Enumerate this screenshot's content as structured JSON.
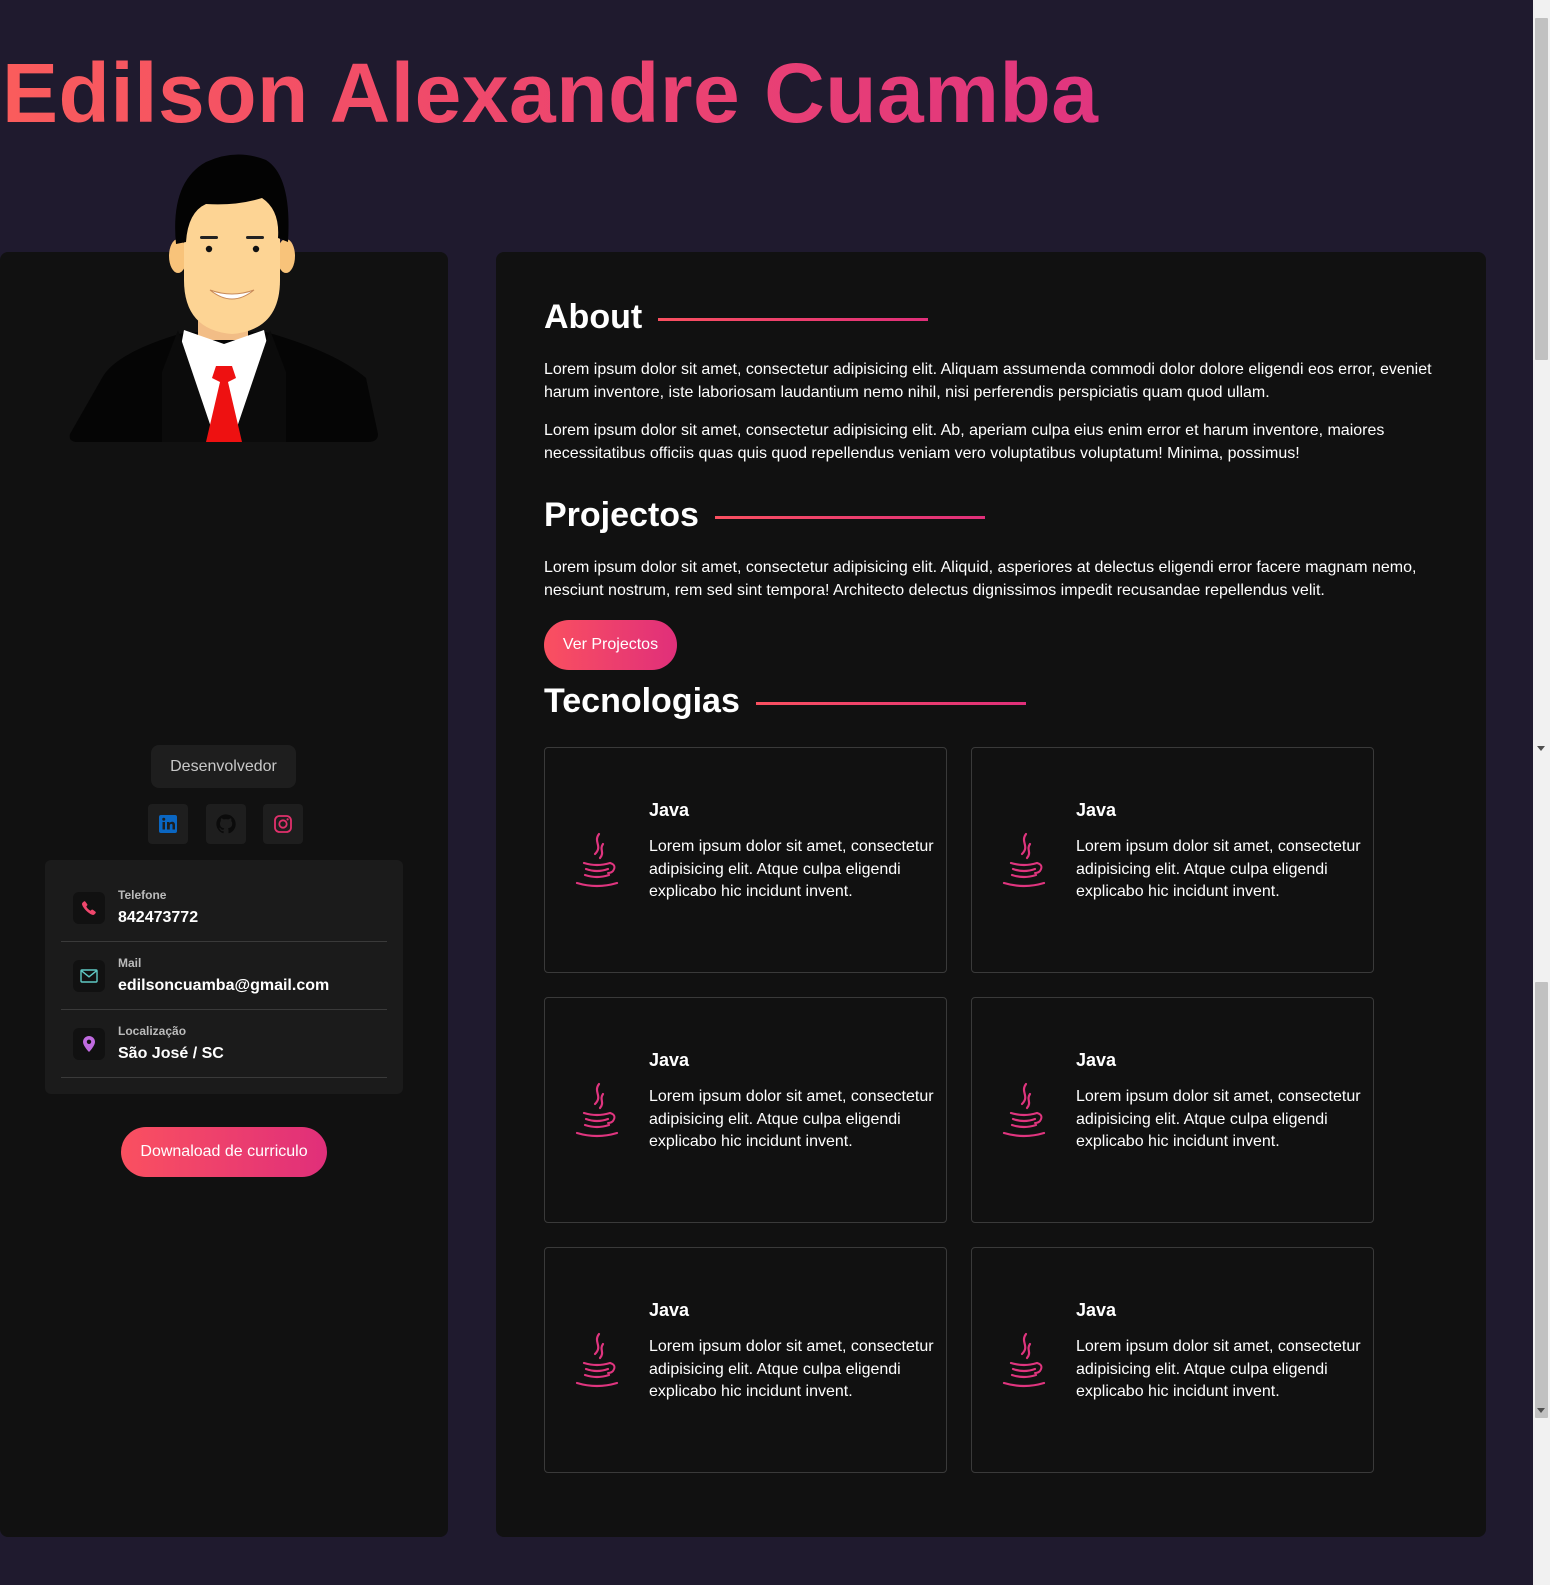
{
  "header": {
    "name": "Edilson Alexandre Cuamba"
  },
  "sidebar": {
    "role": "Desenvolvedor",
    "socials": [
      {
        "icon": "linkedin-icon",
        "color": "#0a66c2"
      },
      {
        "icon": "github-icon",
        "color": "#111111"
      },
      {
        "icon": "instagram-icon",
        "color": "#e1306c"
      }
    ],
    "contacts": [
      {
        "label": "Telefone",
        "value": "842473772",
        "icon": "phone-icon"
      },
      {
        "label": "Mail",
        "value": "edilsoncuamba@gmail.com",
        "icon": "mail-icon"
      },
      {
        "label": "Localização",
        "value": "São José / SC",
        "icon": "location-pin-icon"
      }
    ],
    "download_label": "Downaload de curriculo"
  },
  "main": {
    "about": {
      "title": "About",
      "paragraphs": [
        "Lorem ipsum dolor sit amet, consectetur adipisicing elit. Aliquam assumenda commodi dolor dolore eligendi eos error, eveniet harum inventore, iste laboriosam laudantium nemo nihil, nisi perferendis perspiciatis quam quod ullam.",
        "Lorem ipsum dolor sit amet, consectetur adipisicing elit. Ab, aperiam culpa eius enim error et harum inventore, maiores necessitatibus officiis quas quis quod repellendus veniam vero voluptatibus voluptatum! Minima, possimus!"
      ]
    },
    "projects": {
      "title": "Projectos",
      "paragraph": "Lorem ipsum dolor sit amet, consectetur adipisicing elit. Aliquid, asperiores at delectus eligendi error facere magnam nemo, nesciunt nostrum, rem sed sint tempora! Architecto delectus dignissimos impedit recusandae repellendus velit.",
      "button_label": "Ver Projectos"
    },
    "technologies": {
      "title": "Tecnologias",
      "items": [
        {
          "name": "Java",
          "description": "Lorem ipsum dolor sit amet, consectetur adipisicing elit. Atque culpa eligendi explicabo hic incidunt invent.",
          "icon": "java-icon"
        },
        {
          "name": "Java",
          "description": "Lorem ipsum dolor sit amet, consectetur adipisicing elit. Atque culpa eligendi explicabo hic incidunt invent.",
          "icon": "java-icon"
        },
        {
          "name": "Java",
          "description": "Lorem ipsum dolor sit amet, consectetur adipisicing elit. Atque culpa eligendi explicabo hic incidunt invent.",
          "icon": "java-icon"
        },
        {
          "name": "Java",
          "description": "Lorem ipsum dolor sit amet, consectetur adipisicing elit. Atque culpa eligendi explicabo hic incidunt invent.",
          "icon": "java-icon"
        },
        {
          "name": "Java",
          "description": "Lorem ipsum dolor sit amet, consectetur adipisicing elit. Atque culpa eligendi explicabo hic incidunt invent.",
          "icon": "java-icon"
        },
        {
          "name": "Java",
          "description": "Lorem ipsum dolor sit amet, consectetur adipisicing elit. Atque culpa eligendi explicabo hic incidunt invent.",
          "icon": "java-icon"
        }
      ]
    }
  },
  "colors": {
    "background": "#1f1a2e",
    "panel": "#111111",
    "accent_start": "#fa5060",
    "accent_end": "#e02f7a"
  }
}
